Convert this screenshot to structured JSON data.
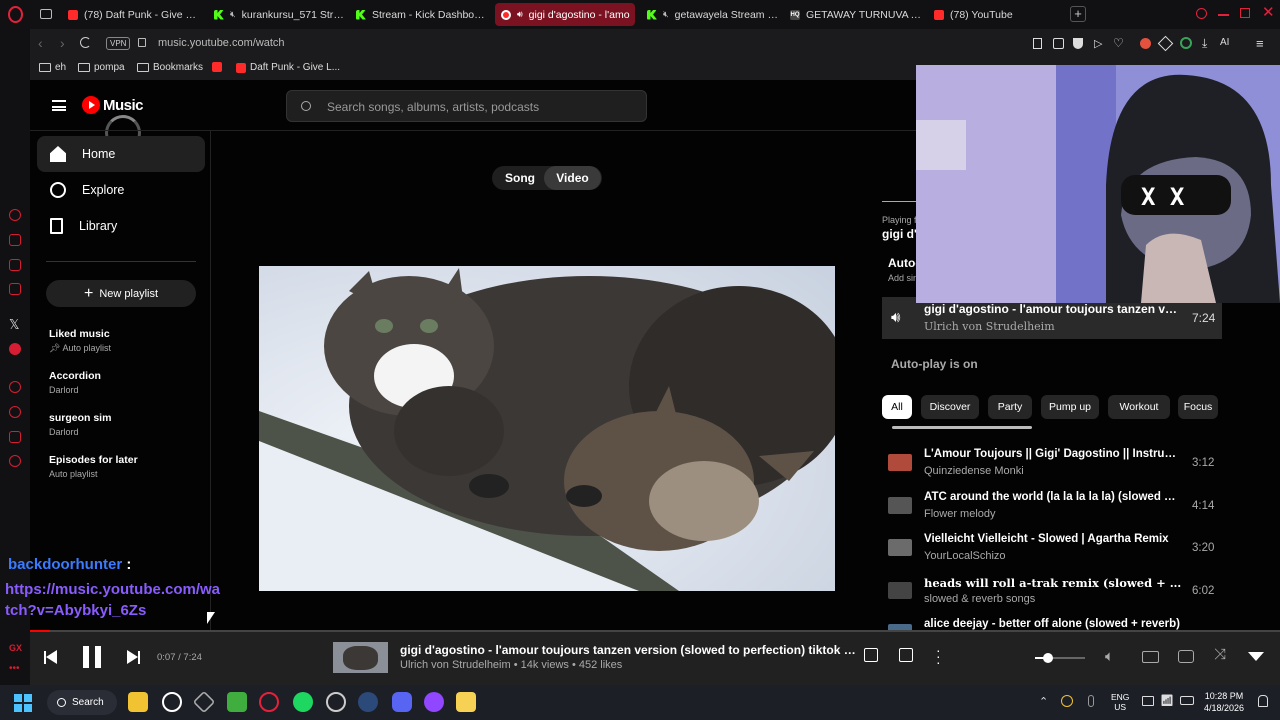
{
  "browser": {
    "tabs": [
      {
        "label": "(78) Daft Punk - Give Life",
        "icon": "youtube-icon"
      },
      {
        "label": "kurankursu_571 Stream",
        "icon": "kick-icon"
      },
      {
        "label": "Stream - Kick Dashboard",
        "icon": "kick-icon"
      },
      {
        "label": "gigi d'agostino - l'amo",
        "icon": "youtube-music-icon"
      },
      {
        "label": "getawayela Stream - V",
        "icon": "kick-icon"
      },
      {
        "label": "GETAWAY TURNUVA AQ",
        "icon": "hq-icon"
      },
      {
        "label": "(78) YouTube",
        "icon": "youtube-icon"
      }
    ],
    "new_tab": "+",
    "vpn": "VPN",
    "url": "music.youtube.com/watch",
    "ai_label": "AI",
    "bookmarks": [
      {
        "label": "eh",
        "icon": "folder-icon"
      },
      {
        "label": "pompa",
        "icon": "folder-icon"
      },
      {
        "label": "Bookmarks",
        "icon": "folder-icon"
      },
      {
        "label": "",
        "icon": "youtube-icon"
      },
      {
        "label": "Daft Punk - Give L...",
        "icon": "youtube-icon"
      }
    ]
  },
  "ytmusic": {
    "logo": "Music",
    "search_placeholder": "Search songs, albums, artists, podcasts",
    "nav": [
      {
        "label": "Home",
        "icon": "home-icon",
        "active": true
      },
      {
        "label": "Explore",
        "icon": "compass-icon",
        "active": false
      },
      {
        "label": "Library",
        "icon": "library-icon",
        "active": false
      }
    ],
    "new_playlist": "New playlist",
    "playlists": [
      {
        "title": "Liked music",
        "subtitle": "Auto playlist",
        "pinned": true
      },
      {
        "title": "Accordion",
        "subtitle": "Darlord",
        "pinned": false
      },
      {
        "title": "surgeon sim",
        "subtitle": "Darlord",
        "pinned": false
      },
      {
        "title": "Episodes for later",
        "subtitle": "Auto playlist",
        "pinned": false
      }
    ],
    "toggle": {
      "song": "Song",
      "video": "Video"
    },
    "playing_from_label": "Playing f",
    "playing_from_value": "gigi d'a",
    "autoplay_label": "Auto-",
    "autoplay_sub": "Add sin",
    "now_playing": {
      "title": "gigi d'agostino - l'amour toujours tanzen vers...",
      "artist": "Ulrich von Strudelheim",
      "duration": "7:24"
    },
    "autoplay_on": "Auto-play is on",
    "chips": [
      "All",
      "Discover",
      "Party",
      "Pump up",
      "Workout",
      "Focus"
    ],
    "queue": [
      {
        "title": "L'Amour Toujours || Gigi' Dagostino || Instrume...",
        "artist": "Quinziedense Monki",
        "duration": "3:12",
        "color": "#b04a3b"
      },
      {
        "title": "ATC around the world (la la la la la) (slowed + r...",
        "artist": "Flower melody",
        "duration": "4:14",
        "color": "#555555"
      },
      {
        "title": "Vielleicht Vielleicht - Slowed | Agartha Remix",
        "artist": "YourLocalSchizo",
        "duration": "3:20",
        "color": "#6b6b6b"
      },
      {
        "title": "heads will roll a-trak remix (slowed + reverb)",
        "artist": "slowed & reverb songs",
        "duration": "6:02",
        "color": "#444444"
      },
      {
        "title": "alice deejay - better off alone (slowed + reverb)",
        "artist": "",
        "duration": "",
        "color": "#4a6a8a"
      }
    ]
  },
  "player": {
    "time": "0:07 / 7:24",
    "progress": 0.016,
    "title": "gigi d'agostino - l'amour toujours tanzen version (slowed to perfection) tiktok version",
    "meta": "Ulrich von Strudelheim • 14k views • 452 likes",
    "volume": 0.25
  },
  "chat": {
    "user": "backdoorhunter",
    "sep": ":",
    "message": "https://music.youtube.com/watch?v=Abybkyi_6Zs"
  },
  "taskbar": {
    "search": "Search",
    "lang1": "ENG",
    "lang2": "US",
    "time": "10:28 PM",
    "date": "4/18/2026"
  },
  "colors": {
    "accent": "#ff0000",
    "opera": "#d61d33",
    "chat_user": "#3a7bff",
    "chat_msg": "#8a5cff"
  }
}
